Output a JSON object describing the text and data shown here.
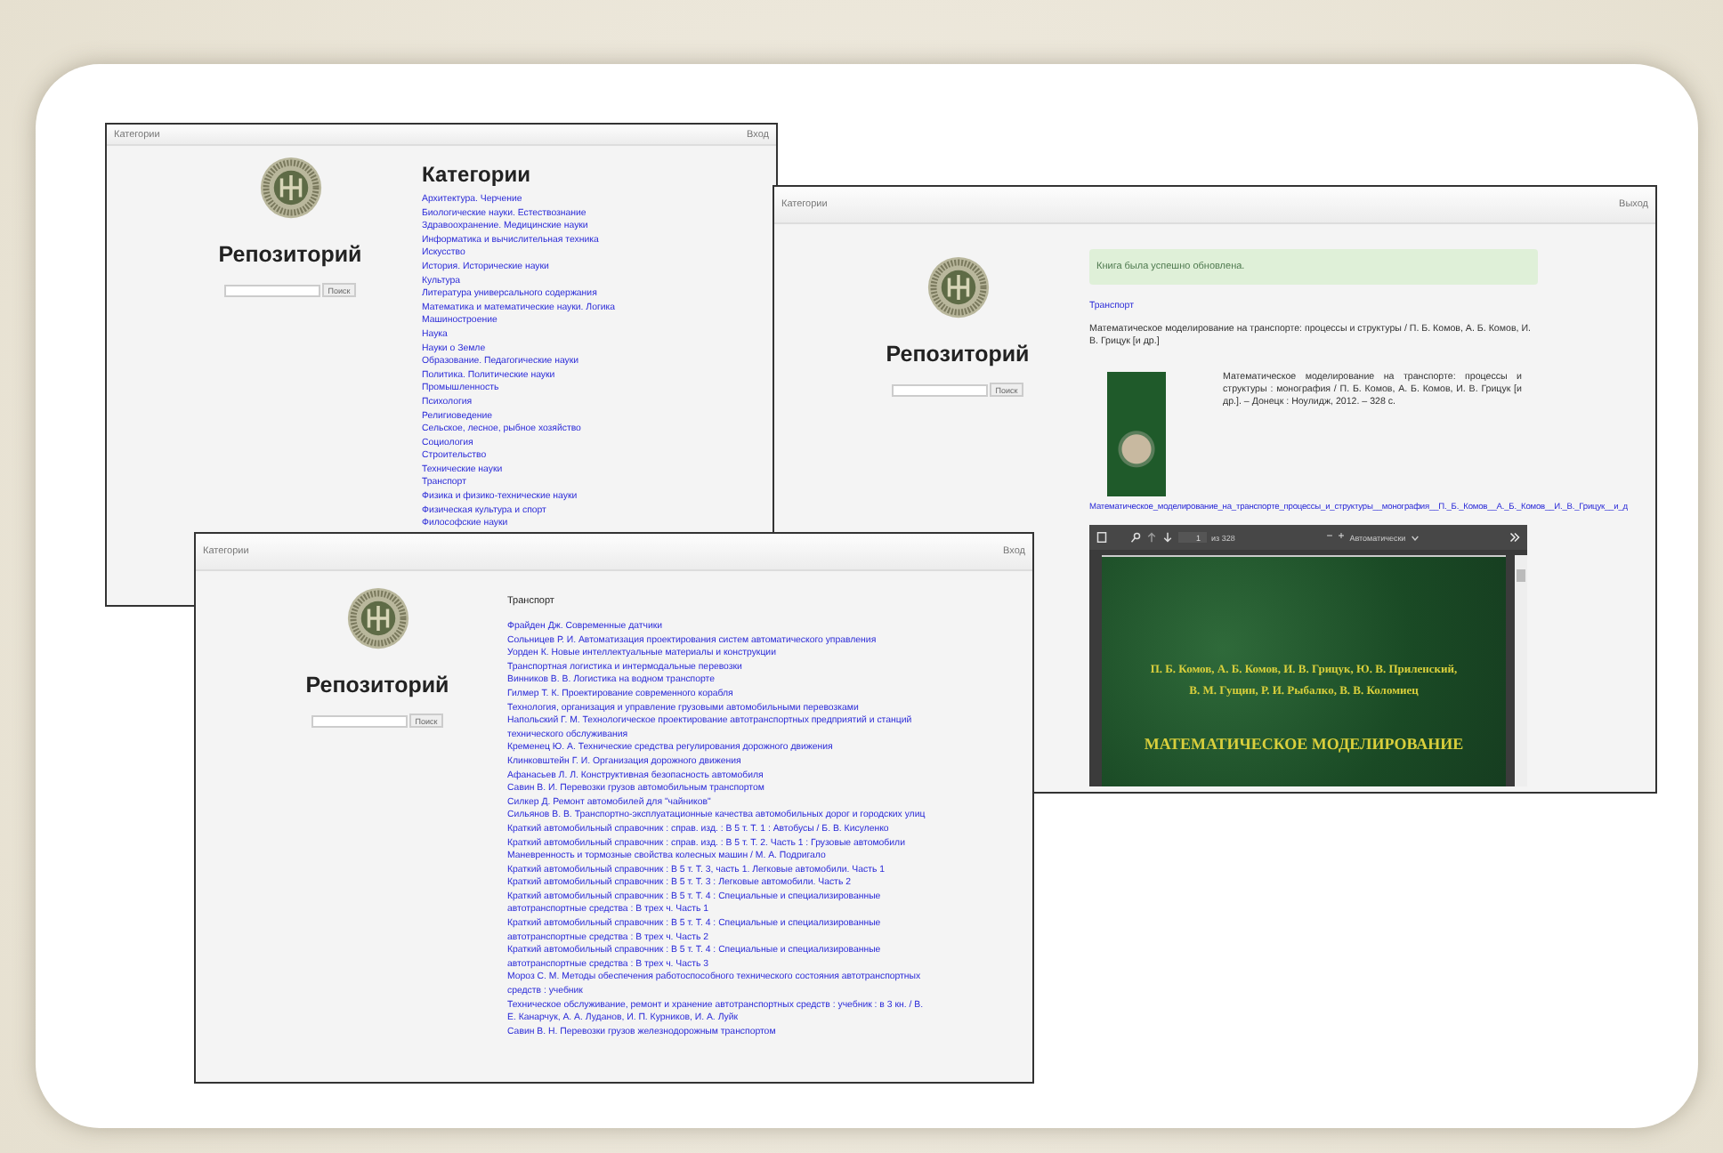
{
  "slide": {
    "categories_window": {
      "nav": {
        "left": "Категории",
        "right": "Вход"
      },
      "sidebar": {
        "title": "Репозиторий",
        "search_button": "Поиск"
      },
      "heading": "Категории",
      "categories": [
        "Архитектура. Черчение",
        "Биологические науки. Естествознание",
        "Здравоохранение. Медицинские науки",
        "Информатика и вычислительная техника",
        "Искусство",
        "История. Исторические науки",
        "Культура",
        "Литература универсального содержания",
        "Математика и математические науки. Логика",
        "Машиностроение",
        "Наука",
        "Науки о Земле",
        "Образование. Педагогические науки",
        "Политика. Политические науки",
        "Промышленность",
        "Психология",
        "Религиоведение",
        "Сельское, лесное, рыбное хозяйство",
        "Социология",
        "Строительство",
        "Технические науки",
        "Транспорт",
        "Физика и физико-технические науки",
        "Физическая культура и спорт",
        "Философские науки"
      ]
    },
    "book_window": {
      "nav": {
        "left": "Категории",
        "right": "Выход"
      },
      "sidebar": {
        "title": "Репозиторий",
        "search_button": "Поиск"
      },
      "alert": "Книга была успешно обновлена.",
      "category_link": "Транспорт",
      "description": "Математическое моделирование на транспорте: процессы и структуры / П. Б. Комов, А. Б. Комов, И. В. Грицук [и др.]",
      "details": "Математическое моделирование на транспорте: процессы и структуры : монография / П. Б. Комов, А. Б. Комов, И. В. Грицук [и др.]. – Донецк : Ноулидж, 2012. – 328 с.",
      "file_link": "Математическое_моделирование_на_транспорте_процессы_и_структуры__монография__П._Б._Комов__А._Б._Комов__И._В._Грицук__и_д",
      "pdf_viewer": {
        "page": "1",
        "page_count": "из 328",
        "zoom_out": "−",
        "zoom_in": "+",
        "zoom": "Автоматически",
        "page_lines": [
          {
            "kind": "authors",
            "text": "П. Б. Комов, А. Б. Комов, И. В. Грицук, Ю. В. Приленский,"
          },
          {
            "kind": "authors",
            "text": "В. М. Гущин, Р. И. Рыбалко, В. В. Коломиец"
          },
          {
            "kind": "title",
            "text": "МАТЕМАТИЧЕСКОЕ МОДЕЛИРОВАНИЕ"
          }
        ]
      }
    },
    "transport_window": {
      "nav": {
        "left": "Категории",
        "right": "Вход"
      },
      "sidebar": {
        "title": "Репозиторий",
        "search_button": "Поиск"
      },
      "heading": "Транспорт",
      "books": [
        "Фрайден Дж. Современные датчики",
        "Сольницев Р. И. Автоматизация проектирования систем автоматического управления",
        "Уорден К. Новые интеллектуальные материалы и конструкции",
        "Транспортная логистика и интермодальные перевозки",
        "Винников В. В. Логистика на водном транспорте",
        "Гилмер Т. К. Проектирование современного корабля",
        "Технология, организация и управление грузовыми автомобильными перевозками",
        "Напольский Г. М. Технологическое проектирование автотранспортных предприятий и станций технического обслуживания",
        "Кременец Ю. А. Технические средства регулирования дорожного движения",
        "Клинковштейн Г. И. Организация дорожного движения",
        "Афанасьев Л. Л. Конструктивная безопасность автомобиля",
        "Савин В. И. Перевозки грузов автомобильным транспортом",
        "Силкер Д. Ремонт автомобилей для \"чайников\"",
        "Сильянов В. В. Транспортно-эксплуатационные качества автомобильных дорог и городских улиц",
        "Краткий автомобильный справочник : справ. изд. : В 5 т. Т. 1 : Автобусы / Б. В. Кисуленко",
        "Краткий автомобильный справочник : справ. изд. : В 5 т. Т. 2. Часть 1 : Грузовые автомобили",
        "Маневренность и тормозные свойства колесных машин / М. А. Подригало",
        "Краткий автомобильный справочник : В 5 т. Т. 3, часть 1. Легковые автомобили. Часть 1",
        "Краткий автомобильный справочник : В 5 т. Т. 3 : Легковые автомобили. Часть 2",
        "Краткий автомобильный справочник : В 5 т. Т. 4 : Специальные и специализированные автотранспортные средства : В трех ч. Часть 1",
        "Краткий автомобильный справочник : В 5 т. Т. 4 : Специальные и специализированные автотранспортные средства : В трех ч. Часть 2",
        "Краткий автомобильный справочник : В 5 т. Т. 4 : Специальные и специализированные автотранспортные средства : В трех ч. Часть 3",
        "Мороз С. М. Методы обеспечения работоспособного технического состояния автотранспортных средств : учебник",
        "Техническое обслуживание, ремонт и хранение автотранспортных средств : учебник : в 3 кн. / В. Е. Канарчук, А. А. Луданов, И. П. Курников, И. А. Луйк",
        "Савин В. Н. Перевозки грузов железнодорожным транспортом"
      ]
    }
  }
}
